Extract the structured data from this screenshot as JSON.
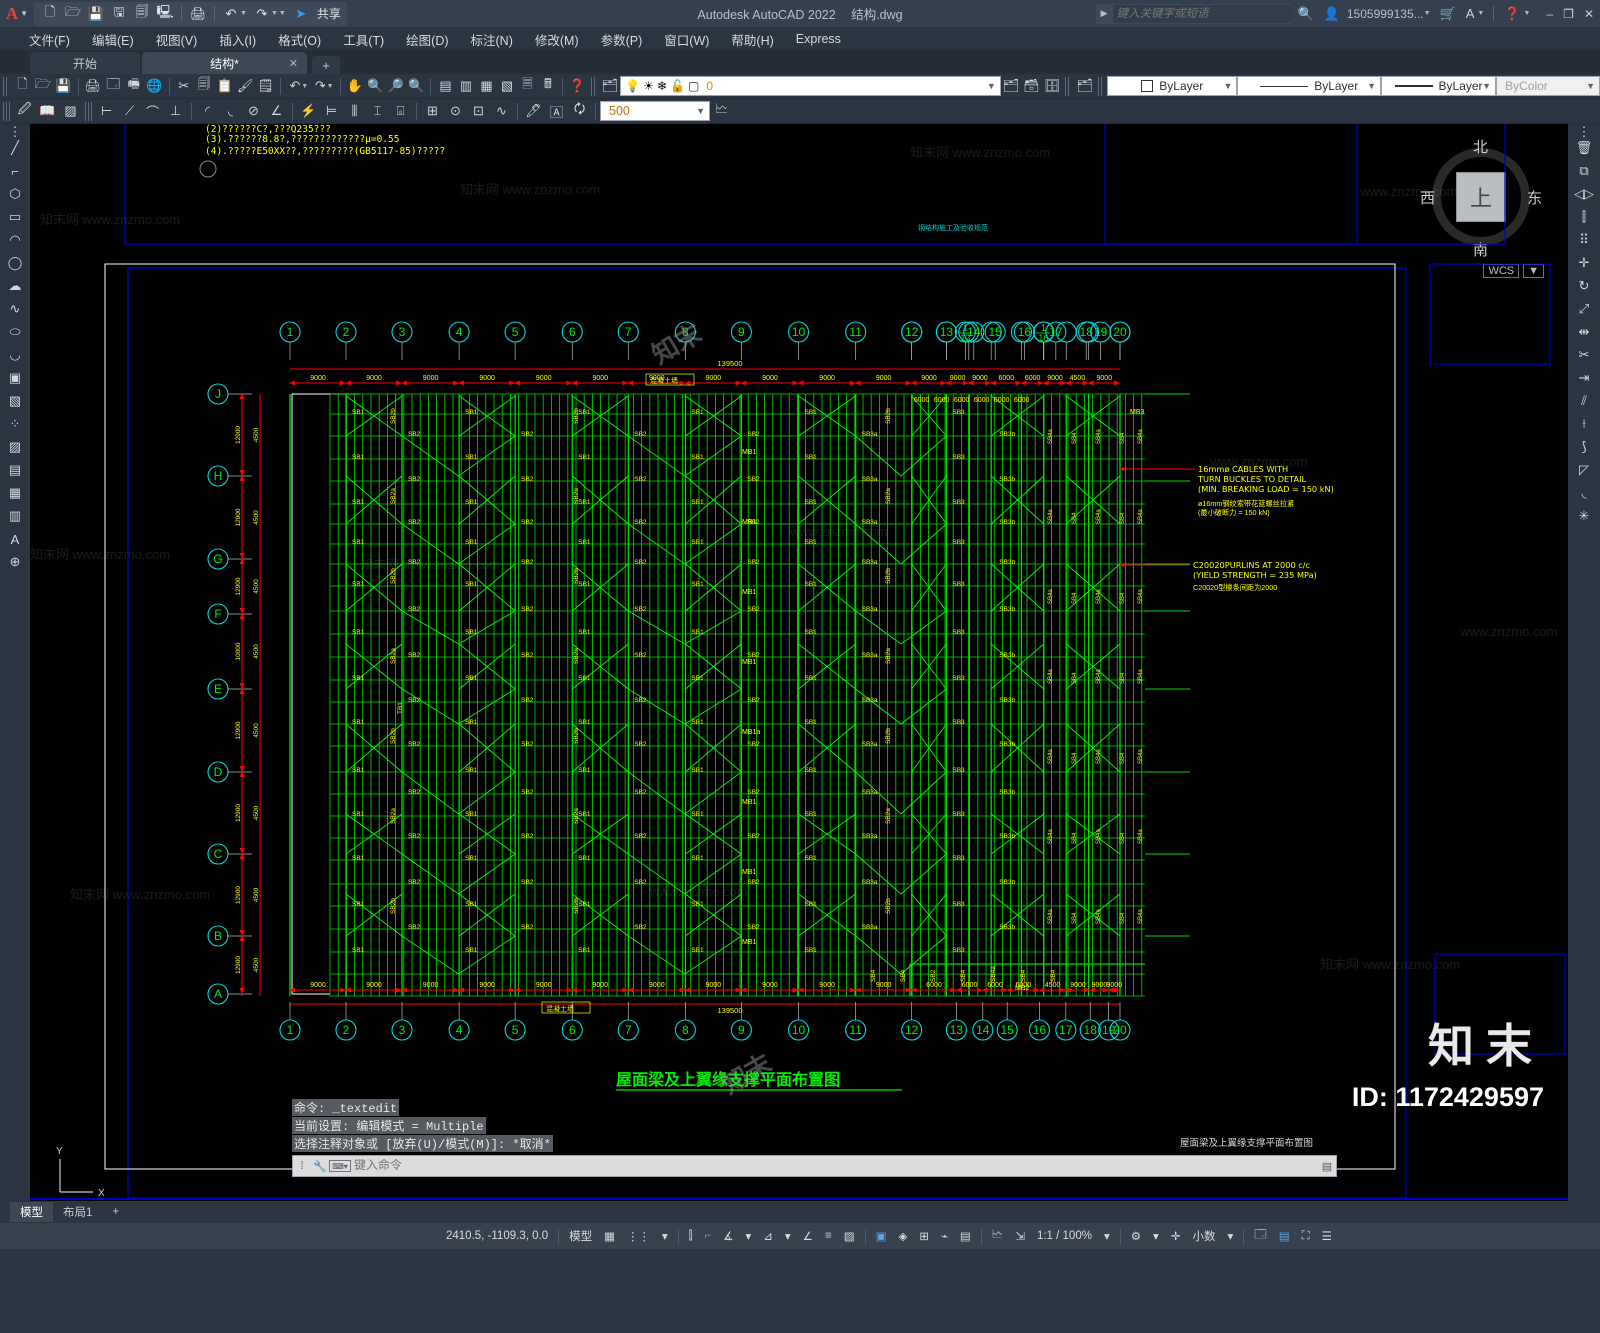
{
  "titlebar": {
    "app_letter": "A",
    "product": "Autodesk AutoCAD 2022",
    "document": "结构.dwg",
    "share_label": "共享",
    "search_placeholder": "键入关键字或短语",
    "account": "1505999135...",
    "quick_access_icons": [
      "new-file-icon",
      "open-folder-icon",
      "save-icon",
      "save-as-icon",
      "save-copy-icon",
      "export-icon",
      "plot-icon",
      "undo-icon",
      "redo-icon",
      "more-icon",
      "share-arrow-icon"
    ]
  },
  "menubar": {
    "items": [
      "文件(F)",
      "编辑(E)",
      "视图(V)",
      "插入(I)",
      "格式(O)",
      "工具(T)",
      "绘图(D)",
      "标注(N)",
      "修改(M)",
      "参数(P)",
      "窗口(W)",
      "帮助(H)",
      "Express"
    ]
  },
  "tabs": {
    "items": [
      {
        "label": "开始",
        "active": false,
        "closeable": false
      },
      {
        "label": "结构*",
        "active": true,
        "closeable": true
      }
    ],
    "add_label": "+"
  },
  "toolbar_props": {
    "layer_name": "0",
    "color": "ByLayer",
    "linetype": "ByLayer",
    "lineweight": "ByLayer",
    "plotstyle": "ByColor",
    "dim_scale": "500"
  },
  "drawing": {
    "notes_lines": [
      "(2)??????C?,???Q235???",
      "(3).??????8.8?,?????????????μ=0.55",
      "(4).?????E50XX??,?????????(GB5117-85)?????"
    ],
    "small_label_top": "钢结构施工及验收规范",
    "title_green": "屋面梁及上翼缘支撑平面布置图",
    "title_block_text": "屋面梁及上翼缘支撑平面布置图",
    "level_labels": [
      "混凝土墙",
      "混凝土墙"
    ],
    "grid_numbers_top": [
      "1",
      "2",
      "3",
      "4",
      "5",
      "6",
      "7",
      "8",
      "9",
      "10",
      "11",
      "12",
      "13",
      "1/13",
      "14",
      "15",
      "16",
      "1/16",
      "17",
      "18",
      "19",
      "20"
    ],
    "grid_numbers_bottom": [
      "1",
      "2",
      "3",
      "4",
      "5",
      "6",
      "7",
      "8",
      "9",
      "10",
      "11",
      "12",
      "13",
      "14",
      "15",
      "16",
      "17",
      "18",
      "19",
      "20"
    ],
    "grid_letters": [
      "J",
      "H",
      "G",
      "F",
      "E",
      "D",
      "C",
      "B",
      "A"
    ],
    "dim_top_row": [
      "9000",
      "9000",
      "9000",
      "9000",
      "9000",
      "9000",
      "9000",
      "9000",
      "9000",
      "9000",
      "9000",
      "9000",
      "9000",
      "9000",
      "6000",
      "6000",
      "9000",
      "4500",
      "9000"
    ],
    "dim_top_sub": [
      "6000",
      "6000",
      "6000",
      "6000",
      "6000",
      "6000"
    ],
    "dim_total": "139500",
    "dim_bottom_row": [
      "9000",
      "9000",
      "9000",
      "9000",
      "9000",
      "9000",
      "9000",
      "9000",
      "9000",
      "9000",
      "9000",
      "6000",
      "6000",
      "6000",
      "6000",
      "4500",
      "9000"
    ],
    "dim_bottom_total": "139500",
    "dim_vertical": [
      "12900",
      "4500",
      "12900",
      "4500",
      "12900",
      "4500",
      "10000",
      "4500",
      "12900",
      "4500",
      "12900",
      "4500",
      "12900",
      "4500",
      "12900",
      "4500"
    ],
    "annotations": [
      {
        "name": "cable-note",
        "en": [
          "16mmø CABLES WITH",
          "TURN BUCKLES TO DETAIL",
          "(MIN. BREAKING LOAD = 150 kN)"
        ],
        "cn": [
          "ø16mm钢绞索带花篮螺丝拉紧",
          "(最小破断力 = 150 kN)"
        ]
      },
      {
        "name": "purlin-note",
        "en": [
          "C20020PURLINS AT 2000 c/c",
          "(YIELD STRENGTH = 235 MPa)"
        ],
        "cn": [
          "C20020型檩条间距为2000"
        ]
      }
    ],
    "member_tags": [
      "SB1",
      "SB2",
      "SB2a",
      "SB2b",
      "SB3",
      "SB3a",
      "SB3b",
      "SB4",
      "SB4a",
      "MB1",
      "MB1a",
      "MB2",
      "MB3",
      "TB1"
    ],
    "coordinate_display": "2410.5, -1109.3, 0.0"
  },
  "viewcube": {
    "top": "北",
    "bottom": "南",
    "left": "西",
    "right": "东",
    "face": "上",
    "wcs_label": "WCS"
  },
  "command": {
    "history": [
      "命令: _textedit",
      "当前设置: 编辑模式 = Multiple",
      "选择注释对象或 [放弃(U)/模式(M)]: *取消*"
    ],
    "input_placeholder": "键入命令"
  },
  "statusbar": {
    "model_tabs": [
      "模型",
      "布局1"
    ],
    "add_layout": "+",
    "coords": "2410.5, -1109.3, 0.0",
    "space_label": "模型",
    "scale": "1:1 / 100%",
    "units": "小数",
    "icons": [
      "grid-icon",
      "snap-icon",
      "ortho-icon",
      "polar-icon",
      "osnap-icon",
      "otrack-icon",
      "lineweight-icon",
      "transparency-icon",
      "selection-cycling-icon",
      "annotation-visibility-icon",
      "autoscale-icon",
      "workspace-icon",
      "hardware-accel-icon",
      "isolate-icon",
      "clean-screen-icon",
      "customization-icon"
    ]
  },
  "watermarks": {
    "brand": "知末",
    "id_label": "ID: 1172429597",
    "url": "知末网 www.znzmo.com"
  },
  "colors": {
    "accent_blue": "#5ba7e8",
    "cad_green": "#00ff00",
    "cad_yellow": "#ffff00",
    "cad_cyan": "#00ffff",
    "cad_red": "#ff0000",
    "cad_blue": "#0000d4",
    "ui_dark": "#2b3441"
  }
}
